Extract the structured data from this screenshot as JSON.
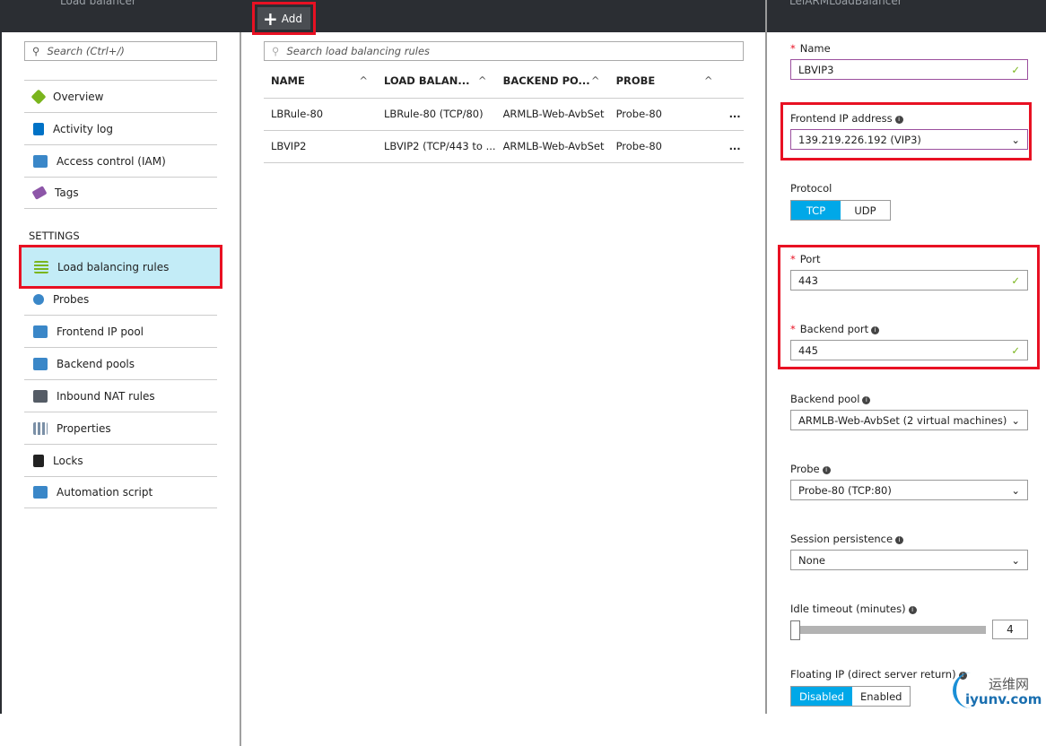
{
  "blades": {
    "left_title": "Load balancer",
    "right_title": "LeiARMLoadBalancer"
  },
  "toolbar": {
    "add_label": "Add"
  },
  "left": {
    "search_placeholder": "Search (Ctrl+/)",
    "section": "SETTINGS",
    "top_items": [
      {
        "label": "Overview",
        "color": "#7ab51d"
      },
      {
        "label": "Activity log",
        "color": "#0072c6"
      },
      {
        "label": "Access control (IAM)",
        "color": "#3a87c8"
      },
      {
        "label": "Tags",
        "color": "#8d56a8"
      }
    ],
    "settings_items": [
      {
        "label": "Load balancing rules",
        "color": "#7ab51d"
      },
      {
        "label": "Probes",
        "color": "#3a87c8"
      },
      {
        "label": "Frontend IP pool",
        "color": "#3a87c8"
      },
      {
        "label": "Backend pools",
        "color": "#3a87c8"
      },
      {
        "label": "Inbound NAT rules",
        "color": "#555c66"
      },
      {
        "label": "Properties",
        "color": "#7a8fa6"
      },
      {
        "label": "Locks",
        "color": "#222222"
      },
      {
        "label": "Automation script",
        "color": "#3a87c8"
      }
    ]
  },
  "middle": {
    "search_placeholder": "Search load balancing rules",
    "columns": [
      "NAME",
      "LOAD BALAN...",
      "BACKEND PO...",
      "PROBE"
    ],
    "rows": [
      [
        "LBRule-80",
        "LBRule-80 (TCP/80)",
        "ARMLB-Web-AvbSet",
        "Probe-80"
      ],
      [
        "LBVIP2",
        "LBVIP2 (TCP/443 to ...",
        "ARMLB-Web-AvbSet",
        "Probe-80"
      ]
    ],
    "more": "..."
  },
  "form": {
    "name_label": "Name",
    "name_value": "LBVIP3",
    "frontend_label": "Frontend IP address",
    "frontend_value": "139.219.226.192 (VIP3)",
    "protocol_label": "Protocol",
    "protocol_options": [
      "TCP",
      "UDP"
    ],
    "port_label": "Port",
    "port_value": "443",
    "backend_port_label": "Backend port",
    "backend_port_value": "445",
    "backend_pool_label": "Backend pool",
    "backend_pool_value": "ARMLB-Web-AvbSet (2 virtual machines)",
    "probe_label": "Probe",
    "probe_value": "Probe-80 (TCP:80)",
    "session_label": "Session persistence",
    "session_value": "None",
    "idle_label": "Idle timeout (minutes)",
    "idle_value": "4",
    "floating_label": "Floating IP (direct server return)",
    "floating_options": [
      "Disabled",
      "Enabled"
    ]
  },
  "watermark": {
    "cn": "运维网",
    "en": "iyunv.com"
  }
}
